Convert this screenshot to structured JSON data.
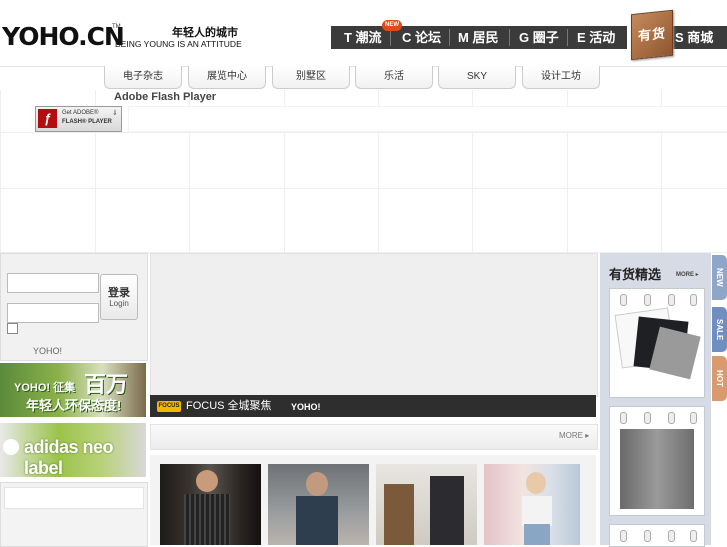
{
  "header": {
    "logo_text": "YOHO.CN",
    "logo_tm": "TM",
    "slogan_cn": "年轻人的城市",
    "slogan_en": "BEING YOUNG IS AN ATTITUDE",
    "new_badge": "NEW",
    "nav": [
      {
        "label": "T 潮流"
      },
      {
        "label": "C 论坛"
      },
      {
        "label": "M 居民"
      },
      {
        "label": "G 圈子"
      },
      {
        "label": "E 活动"
      },
      {
        "label": "S 商城"
      }
    ],
    "shop_box_label": "有货"
  },
  "subnav": {
    "tabs": [
      "电子杂志",
      "展览中心",
      "别墅区",
      "乐活",
      "SKY",
      "设计工坊"
    ]
  },
  "flash": {
    "title": "Adobe Flash Player",
    "get_line1": "Get ADOBE®",
    "get_line2": "FLASH® PLAYER",
    "icon": "flash-player-icon"
  },
  "login": {
    "username_value": "",
    "password_value": "",
    "button_main": "登录",
    "button_sub": "Login",
    "footer_label": "YOHO!"
  },
  "banners": {
    "banner1_small": "YOHO! 征集",
    "banner1_big": "百万",
    "banner1_sub": "年轻人环保态度!",
    "banner2_text": "adidas neo label"
  },
  "focus": {
    "tag": "FOCUS",
    "title": "FOCUS 全城聚焦",
    "brand": "YOHO!",
    "more": "MORE ▸"
  },
  "right": {
    "title": "有货精选",
    "more": "MORE ▸",
    "tabs": [
      {
        "label": "NEW",
        "color": "#8fa6c9"
      },
      {
        "label": "SALE",
        "color": "#6f8fc0"
      },
      {
        "label": "HOT",
        "color": "#d99a6e"
      }
    ]
  },
  "colors": {
    "nav_bg": "#3b3b3b",
    "focus_bar": "#2e2e2e",
    "right_panel": "#d7dbe6",
    "badge": "#e04a1c",
    "focus_tag": "#f1b800"
  }
}
